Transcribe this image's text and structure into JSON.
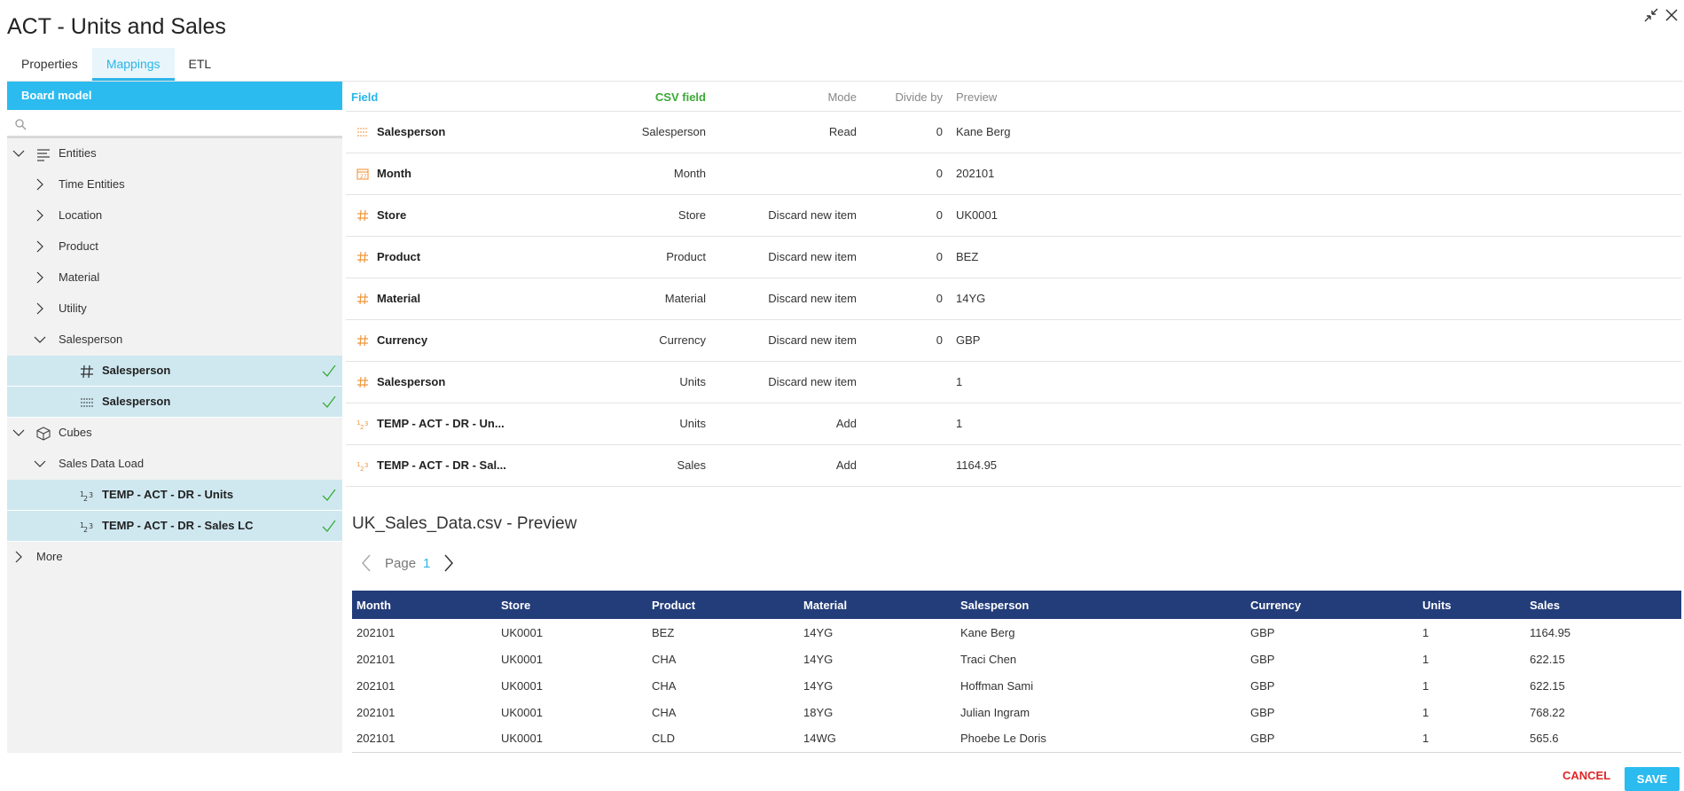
{
  "window": {
    "title": "ACT - Units and Sales"
  },
  "tabs": [
    {
      "label": "Properties",
      "active": false
    },
    {
      "label": "Mappings",
      "active": true
    },
    {
      "label": "ETL",
      "active": false
    }
  ],
  "left_panel": {
    "header": "Board model",
    "search_placeholder": "",
    "tree": {
      "entities": "Entities",
      "time_entities": "Time Entities",
      "location": "Location",
      "product": "Product",
      "material": "Material",
      "utility": "Utility",
      "salesperson": "Salesperson",
      "salesperson_entity_1": "Salesperson",
      "salesperson_entity_2": "Salesperson",
      "cubes": "Cubes",
      "sales_data_load": "Sales Data Load",
      "cube_units": "TEMP - ACT - DR - Units",
      "cube_sales": "TEMP - ACT - DR - Sales LC",
      "more": "More"
    }
  },
  "mapping": {
    "headers": {
      "field": "Field",
      "csv_field": "CSV field",
      "mode": "Mode",
      "divide_by": "Divide by",
      "preview": "Preview"
    },
    "rows": [
      {
        "icon": "lines-icon",
        "field": "Salesperson",
        "csv": "Salesperson",
        "mode": "Read",
        "divide": "0",
        "preview": "Kane Berg"
      },
      {
        "icon": "calendar-icon",
        "field": "Month",
        "csv": "Month",
        "mode": "",
        "divide": "0",
        "preview": "202101"
      },
      {
        "icon": "hash-icon",
        "field": "Store",
        "csv": "Store",
        "mode": "Discard new item",
        "divide": "0",
        "preview": "UK0001"
      },
      {
        "icon": "hash-icon",
        "field": "Product",
        "csv": "Product",
        "mode": "Discard new item",
        "divide": "0",
        "preview": "BEZ"
      },
      {
        "icon": "hash-icon",
        "field": "Material",
        "csv": "Material",
        "mode": "Discard new item",
        "divide": "0",
        "preview": "14YG"
      },
      {
        "icon": "hash-icon",
        "field": "Currency",
        "csv": "Currency",
        "mode": "Discard new item",
        "divide": "0",
        "preview": "GBP"
      },
      {
        "icon": "hash-icon",
        "field": "Salesperson",
        "csv": "Units",
        "mode": "Discard new item",
        "divide": "",
        "preview": "1"
      },
      {
        "icon": "cube-number-icon",
        "field": "TEMP - ACT - DR - Un...",
        "csv": "Units",
        "mode": "Add",
        "divide": "",
        "preview": "1"
      },
      {
        "icon": "cube-number-icon",
        "field": "TEMP - ACT - DR - Sal...",
        "csv": "Sales",
        "mode": "Add",
        "divide": "",
        "preview": "1164.95"
      }
    ]
  },
  "preview": {
    "title": "UK_Sales_Data.csv - Preview",
    "page_label": "Page",
    "page_number": "1",
    "columns": [
      "Month",
      "Store",
      "Product",
      "Material",
      "Salesperson",
      "Currency",
      "Units",
      "Sales"
    ],
    "rows": [
      [
        "202101",
        "UK0001",
        "BEZ",
        "14YG",
        "Kane Berg",
        "GBP",
        "1",
        "1164.95"
      ],
      [
        "202101",
        "UK0001",
        "CHA",
        "14YG",
        "Traci Chen",
        "GBP",
        "1",
        "622.15"
      ],
      [
        "202101",
        "UK0001",
        "CHA",
        "14YG",
        "Hoffman Sami",
        "GBP",
        "1",
        "622.15"
      ],
      [
        "202101",
        "UK0001",
        "CHA",
        "18YG",
        "Julian Ingram",
        "GBP",
        "1",
        "768.22"
      ],
      [
        "202101",
        "UK0001",
        "CLD",
        "14WG",
        "Phoebe Le Doris",
        "GBP",
        "1",
        "565.6"
      ]
    ]
  },
  "footer": {
    "cancel": "CANCEL",
    "save": "SAVE"
  },
  "colors": {
    "accent": "#2bbbef",
    "table_header": "#233d7a",
    "csv_green": "#3aaa35",
    "icon_orange": "#f0963c",
    "cancel_red": "#e02626"
  }
}
